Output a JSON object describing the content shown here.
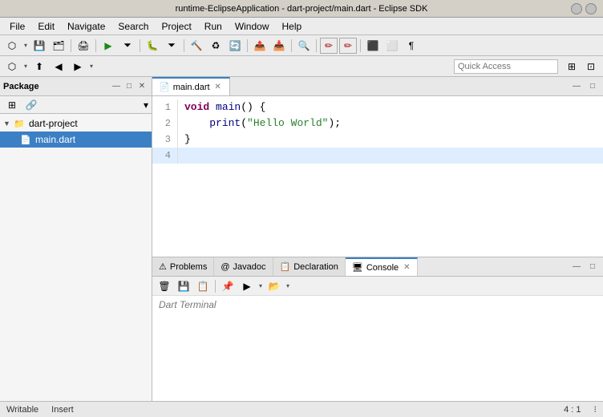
{
  "titleBar": {
    "title": "runtime-EclipseApplication - dart-project/main.dart - Eclipse SDK"
  },
  "menuBar": {
    "items": [
      "File",
      "Edit",
      "Navigate",
      "Search",
      "Project",
      "Run",
      "Window",
      "Help"
    ]
  },
  "toolbar1": {
    "buttons": [
      "⬡",
      "💾",
      "📋",
      "✂",
      "📄",
      "↩",
      "↪",
      "🔍",
      "▶",
      "⏹",
      "🐛",
      "⚙",
      "⚡",
      "📦",
      "♻",
      "🔄",
      "📤",
      "🌐",
      "✏",
      "✏"
    ]
  },
  "toolbar2": {
    "buttons": [
      "⬡",
      "▲",
      "↑",
      "↓",
      "→"
    ],
    "quickAccess": "Quick Access"
  },
  "sidebar": {
    "title": "Package",
    "tree": {
      "project": "dart-project",
      "file": "main.dart"
    }
  },
  "editor": {
    "tab": {
      "filename": "main.dart",
      "icon": "📄"
    },
    "lines": [
      {
        "num": "1",
        "content": "void main() {",
        "highlighted": false
      },
      {
        "num": "2",
        "content": "    print(\"Hello World\");",
        "highlighted": false
      },
      {
        "num": "3",
        "content": "}",
        "highlighted": false
      },
      {
        "num": "4",
        "content": "",
        "highlighted": true
      }
    ]
  },
  "bottomPanel": {
    "tabs": [
      {
        "label": "Problems",
        "icon": "⚠",
        "active": false
      },
      {
        "label": "Javadoc",
        "icon": "@",
        "active": false
      },
      {
        "label": "Declaration",
        "icon": "📋",
        "active": false
      },
      {
        "label": "Console",
        "icon": "🖥",
        "active": true
      }
    ],
    "consoleContent": "Dart Terminal"
  },
  "statusBar": {
    "left": "Writable",
    "middle": "Insert",
    "position": "4 : 1"
  }
}
